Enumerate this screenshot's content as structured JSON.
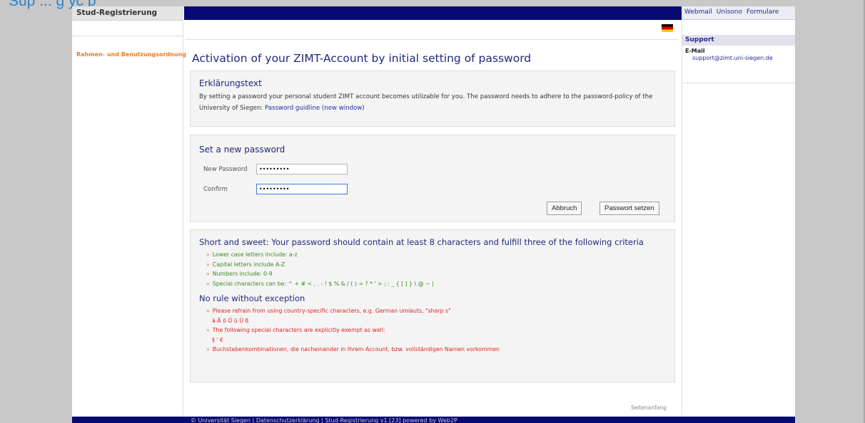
{
  "top_fragment": "Sup ... g yc p",
  "left": {
    "brand": "Stud-Registrierung",
    "link": "Rahmen- und Benutzungsordnung"
  },
  "right": {
    "links": [
      "Webmail",
      "Unisono",
      "Formulare"
    ],
    "support_heading": "Support",
    "email_label": "E-Mail",
    "email": "support@zimt.uni-siegen.de"
  },
  "main": {
    "title": "Activation of your ZIMT-Account by initial setting of password",
    "intro": {
      "heading": "Erklärungstext",
      "text": "By setting a password your personal student ZIMT account becomes utilizable for you. The password needs to adhere to the password-policy of the University of Siegen: ",
      "link": "Password guidline (new window)"
    },
    "form": {
      "heading": "Set a new password",
      "new_label": "New Password",
      "new_value": "•••••••••",
      "confirm_label": "Confirm",
      "confirm_value": "•••••••••",
      "cancel_label": "Abbruch",
      "submit_label": "Passwort setzen"
    },
    "rules": {
      "heading": "Short and sweet: Your password should contain at least 8 characters and fulfill three of the following criteria",
      "criteria": [
        "Lower case letters include: a-z",
        "Capital letters include A-Z",
        "Numbers include: 0-9",
        "Special characters can be: ^ + # < , . - ! $ % & / ( ) = ? * ' > ; : _ { [ ] } \\ @ ~ |"
      ],
      "exception_heading": "No rule without exception",
      "exceptions": [
        "Please refrain from using country-specific characters, e.g. German umlauts, \"sharp s\"",
        "ä Ä ö Ö ü Ü ß",
        "The following special characters are explicitly exempt as well:",
        "§ ' €",
        "Buchstabenkombinationen, die nacheinander in Ihrem Account, bzw. vollständigen Namen vorkommen"
      ]
    },
    "back_to_top": "Seitenanfang"
  },
  "footer": "© Universität Siegen | Datenschutzerklärung | Stud-Registrierung v1.[23] powered by Web2P"
}
